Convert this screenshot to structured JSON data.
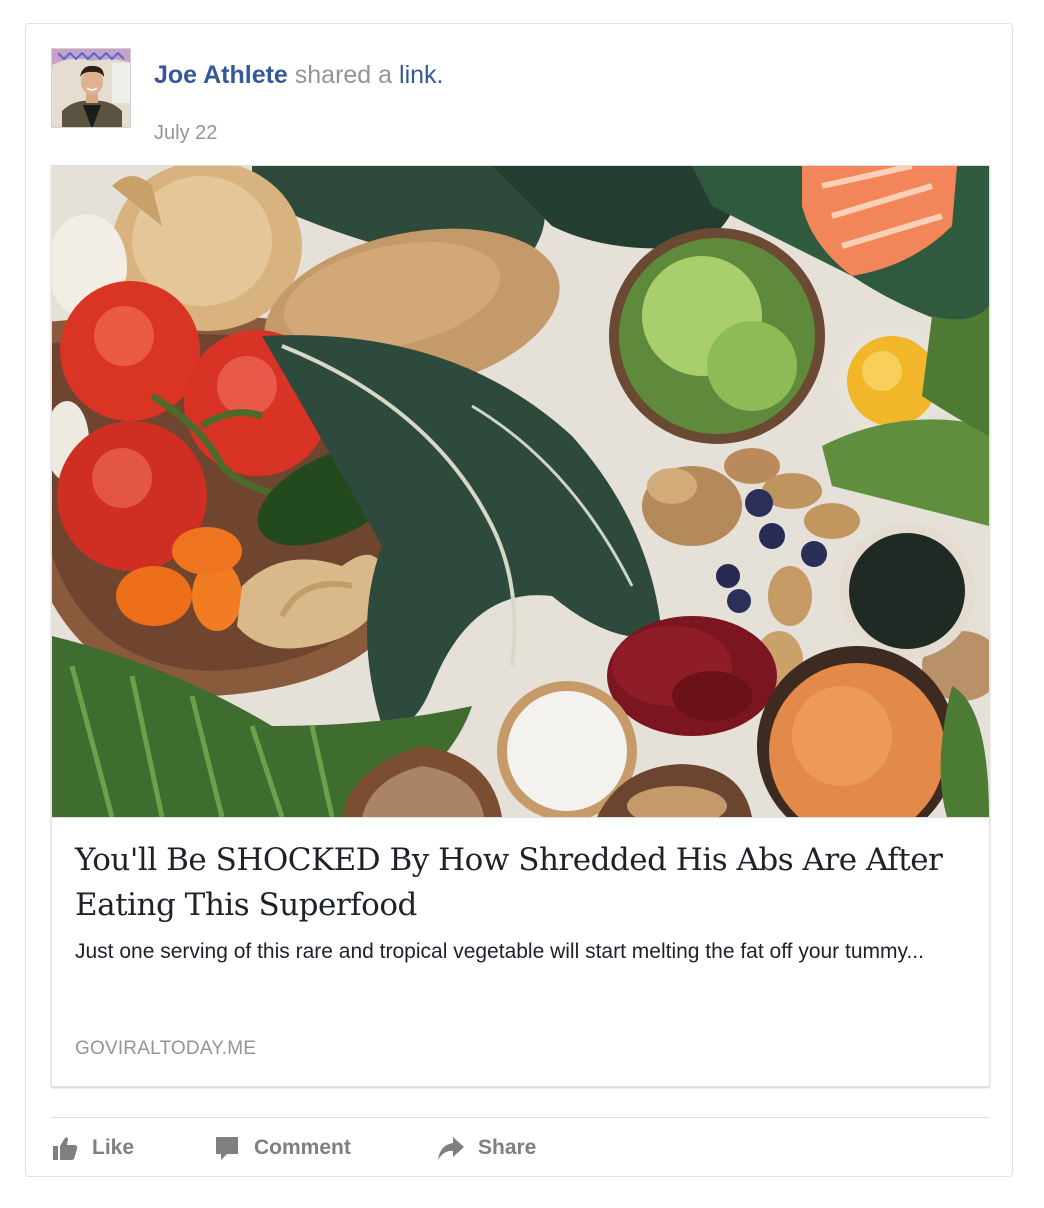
{
  "post": {
    "author": "Joe Athlete",
    "action_text": " shared a ",
    "link_word": "link",
    "period": ".",
    "date": "July 22"
  },
  "attachment": {
    "headline": "You'll Be SHOCKED By How Shredded His Abs Are After Eating This Superfood",
    "description": "Just one serving of this rare and tropical vegetable will start melting the fat off your tummy...",
    "domain": "GOVIRALTODAY.ME"
  },
  "actions": {
    "like": "Like",
    "comment": "Comment",
    "share": "Share"
  },
  "icons": {
    "like": "thumbs-up-icon",
    "comment": "speech-bubble-icon",
    "share": "share-arrow-icon"
  },
  "colors": {
    "link_blue": "#365899",
    "meta_gray": "#90949c",
    "action_gray": "#7f7f7f",
    "text": "#1d2129",
    "border": "#dddfe2"
  }
}
